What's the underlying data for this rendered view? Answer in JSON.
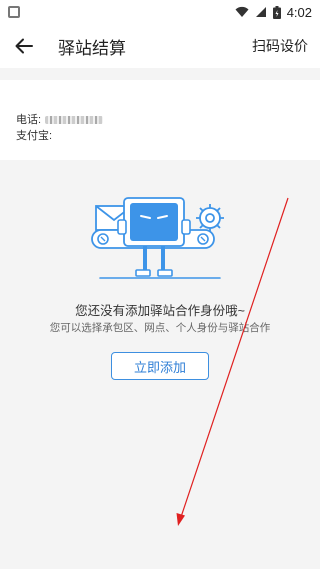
{
  "status_bar": {
    "time": "4:02",
    "icons": [
      "app-square-icon",
      "wifi-icon",
      "signal-icon",
      "battery-icon"
    ]
  },
  "header": {
    "title": "驿站结算",
    "action_label": "扫码设价",
    "back_icon": "arrow-left-icon"
  },
  "account": {
    "phone_label": "电话:",
    "alipay_label": "支付宝:"
  },
  "empty_state": {
    "illustration": "robot-envelope-gear-illustration",
    "title": "您还没有添加驿站合作身份哦~",
    "subtitle": "您可以选择承包区、网点、个人身份与驿站合作",
    "button_label": "立即添加"
  },
  "annotation": {
    "type": "red-arrow",
    "color": "#e02020"
  },
  "colors": {
    "accent": "#2f7fd6",
    "background": "#f4f4f4",
    "illustration_blue": "#3d94e8"
  }
}
